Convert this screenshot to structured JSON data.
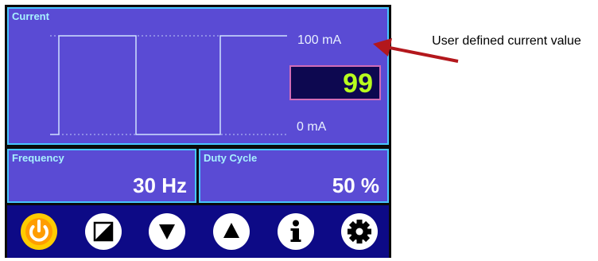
{
  "current_panel": {
    "label": "Current",
    "max_label": "100 mA",
    "min_label": "0 mA",
    "value": "99"
  },
  "frequency_panel": {
    "label": "Frequency",
    "value": "30 Hz"
  },
  "duty_panel": {
    "label": "Duty Cycle",
    "value": "50 %"
  },
  "toolbar": {
    "buttons": [
      {
        "name": "power",
        "icon": "power-icon"
      },
      {
        "name": "contrast",
        "icon": "contrast-icon"
      },
      {
        "name": "down",
        "icon": "triangle-down-icon"
      },
      {
        "name": "up",
        "icon": "triangle-up-icon"
      },
      {
        "name": "info",
        "icon": "info-icon"
      },
      {
        "name": "settings",
        "icon": "gear-icon"
      }
    ]
  },
  "annotation": {
    "text": "User defined current value",
    "arrow_color": "#b3171c"
  },
  "colors": {
    "panel_bg": "#5a4bd4",
    "panel_border": "#47c6ff",
    "value_text": "#b8ff1e",
    "toolbar_bg": "#0d0a86",
    "power_ring": "#ff9d00"
  }
}
